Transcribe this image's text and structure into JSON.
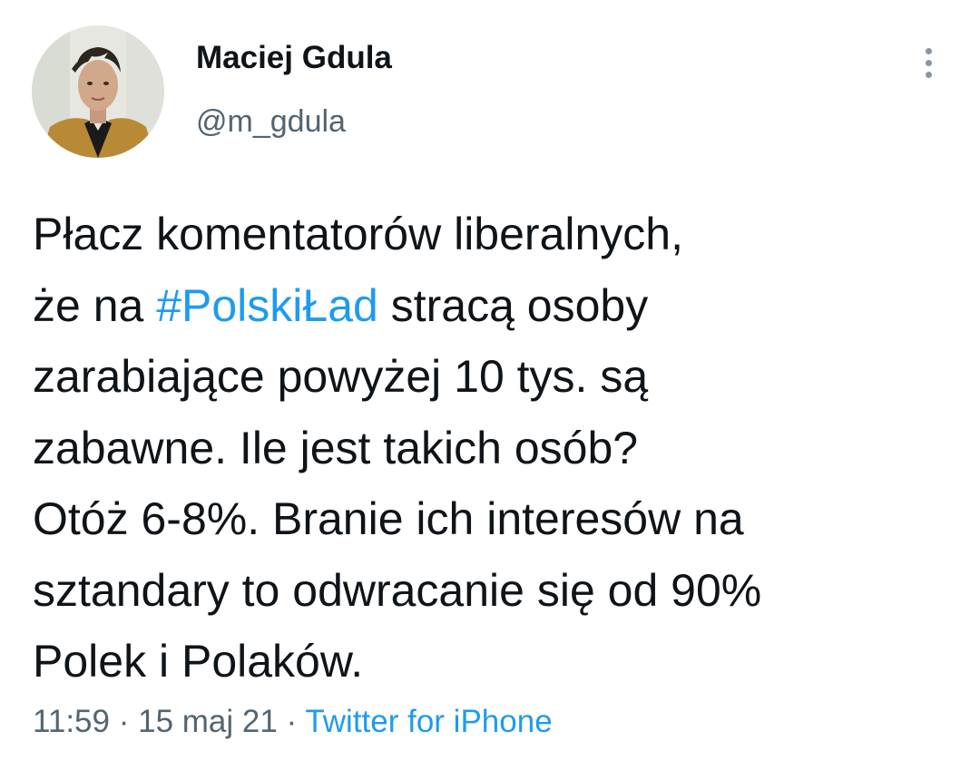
{
  "author": {
    "display_name": "Maciej Gdula",
    "handle": "@m_gdula",
    "avatar": "profile-photo"
  },
  "menu": {
    "icon": "more-vertical-icon"
  },
  "tweet": {
    "lines": [
      {
        "before": "Płacz komentatorów liberalnych,",
        "hashtag": "",
        "after": ""
      },
      {
        "before": "że na ",
        "hashtag": "#PolskiŁad",
        "after": " stracą osoby"
      },
      {
        "before": "zarabiające powyżej 10 tys. są",
        "hashtag": "",
        "after": ""
      },
      {
        "before": "zabawne. Ile jest takich osób?",
        "hashtag": "",
        "after": ""
      },
      {
        "before": "Otóż 6-8%. Branie ich interesów na",
        "hashtag": "",
        "after": ""
      },
      {
        "before": "sztandary to odwracanie się od 90%",
        "hashtag": "",
        "after": ""
      },
      {
        "before": "Polek i Polaków.",
        "hashtag": "",
        "after": ""
      }
    ]
  },
  "meta": {
    "time": "11:59",
    "separator": " · ",
    "date": "15 maj 21",
    "source": "Twitter for iPhone"
  },
  "colors": {
    "link": "#1d9bf0",
    "text": "#0f1419",
    "secondary": "#536471"
  }
}
